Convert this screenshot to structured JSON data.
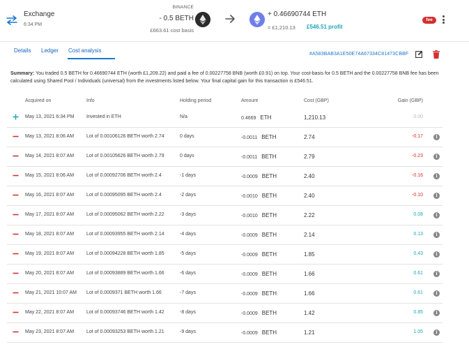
{
  "header": {
    "type": "Exchange",
    "time": "6:34 PM",
    "from": {
      "exchange": "BINANCE",
      "amount": "- 0.5 BETH",
      "basis": "£663.61 cost basis"
    },
    "to": {
      "amount": "+ 0.46690744 ETH",
      "value": "= £1,210.13",
      "profit": "£546.51 profit"
    },
    "fee_badge": "fee"
  },
  "tabs": [
    {
      "label": "Details"
    },
    {
      "label": "Ledger"
    },
    {
      "label": "Cost analysis"
    }
  ],
  "tx_hash": "#A583BAB3A1E50E74A67334C81473CBBF",
  "summary": {
    "label": "Summary:",
    "text": "You traded 0.5 BETH for 0.46690744 ETH (worth £1,209.22) and paid a fee of 0.00227758 BNB (worth £0.91) on top. Your cost-basis for 0.5 BETH and the 0.00227758 BNB fee has been calculated using Shared Pool / Individuals (universal) from the investments listed below. Your final capital gain for this transaction is £546.51."
  },
  "columns": {
    "acquired": "Acquired on",
    "info": "Info",
    "holding": "Holding period",
    "amount": "Amount",
    "cost": "Cost (GBP)",
    "gain": "Gain (GBP)"
  },
  "colors": {
    "accent": "#1976d2",
    "positive": "#1fa7b5",
    "negative": "#d32f2f",
    "neutral": "#bbbbbb"
  },
  "rows": [
    {
      "icon": "plus-icon",
      "date": "May 13, 2021 6:34 PM",
      "info": "Invested in ETH",
      "holding": "N/a",
      "amount": "0.4669",
      "asset": "ETH",
      "cost": "1,210.13",
      "gain": "0.00",
      "gain_sign": "neutral",
      "info_btn": false
    },
    {
      "icon": "minus-icon",
      "date": "May 13, 2021 8:06 AM",
      "info": "Lot of 0.00106126 BETH worth 2.74",
      "holding": "0 days",
      "amount": "-0.0011",
      "asset": "BETH",
      "cost": "2.74",
      "gain": "-0.17",
      "gain_sign": "negative",
      "info_btn": true
    },
    {
      "icon": "minus-icon",
      "date": "May 14, 2021 8:07 AM",
      "info": "Lot of 0.00105626 BETH worth 2.79",
      "holding": "0 days",
      "amount": "-0.0011",
      "asset": "BETH",
      "cost": "2.79",
      "gain": "-0.23",
      "gain_sign": "negative",
      "info_btn": true
    },
    {
      "icon": "minus-icon",
      "date": "May 15, 2021 8:06 AM",
      "info": "Lot of 0.00092706 BETH worth 2.4",
      "holding": "-1 days",
      "amount": "-0.0009",
      "asset": "BETH",
      "cost": "2.40",
      "gain": "-0.16",
      "gain_sign": "negative",
      "info_btn": true
    },
    {
      "icon": "minus-icon",
      "date": "May 16, 2021 8:07 AM",
      "info": "Lot of 0.00095095 BETH worth 2.4",
      "holding": "-2 days",
      "amount": "-0.0010",
      "asset": "BETH",
      "cost": "2.40",
      "gain": "-0.10",
      "gain_sign": "negative",
      "info_btn": true
    },
    {
      "icon": "minus-icon",
      "date": "May 17, 2021 8:07 AM",
      "info": "Lot of 0.00095062 BETH worth 2.22",
      "holding": "-3 days",
      "amount": "-0.0010",
      "asset": "BETH",
      "cost": "2.22",
      "gain": "0.08",
      "gain_sign": "positive",
      "info_btn": true
    },
    {
      "icon": "minus-icon",
      "date": "May 18, 2021 8:07 AM",
      "info": "Lot of 0.00093955 BETH worth 2.14",
      "holding": "-4 days",
      "amount": "-0.0009",
      "asset": "BETH",
      "cost": "2.14",
      "gain": "0.13",
      "gain_sign": "positive",
      "info_btn": true
    },
    {
      "icon": "minus-icon",
      "date": "May 19, 2021 8:07 AM",
      "info": "Lot of 0.00094228 BETH worth 1.85",
      "holding": "-5 days",
      "amount": "-0.0009",
      "asset": "BETH",
      "cost": "1.85",
      "gain": "0.43",
      "gain_sign": "positive",
      "info_btn": true
    },
    {
      "icon": "minus-icon",
      "date": "May 20, 2021 8:07 AM",
      "info": "Lot of 0.00093889 BETH worth 1.66",
      "holding": "-6 days",
      "amount": "-0.0009",
      "asset": "BETH",
      "cost": "1.66",
      "gain": "0.61",
      "gain_sign": "positive",
      "info_btn": true
    },
    {
      "icon": "minus-icon",
      "date": "May 21, 2021 10:07 AM",
      "info": "Lot of 0.0009371 BETH worth 1.66",
      "holding": "-7 days",
      "amount": "-0.0009",
      "asset": "BETH",
      "cost": "1.66",
      "gain": "0.61",
      "gain_sign": "positive",
      "info_btn": true
    },
    {
      "icon": "minus-icon",
      "date": "May 22, 2021 8:07 AM",
      "info": "Lot of 0.00093746 BETH worth 1.42",
      "holding": "-8 days",
      "amount": "-0.0009",
      "asset": "BETH",
      "cost": "1.42",
      "gain": "0.85",
      "gain_sign": "positive",
      "info_btn": true
    },
    {
      "icon": "minus-icon",
      "date": "May 23, 2021 8:07 AM",
      "info": "Lot of 0.00093253 BETH worth 1.21",
      "holding": "-9 days",
      "amount": "-0.0009",
      "asset": "BETH",
      "cost": "1.21",
      "gain": "1.05",
      "gain_sign": "positive",
      "info_btn": true
    }
  ]
}
